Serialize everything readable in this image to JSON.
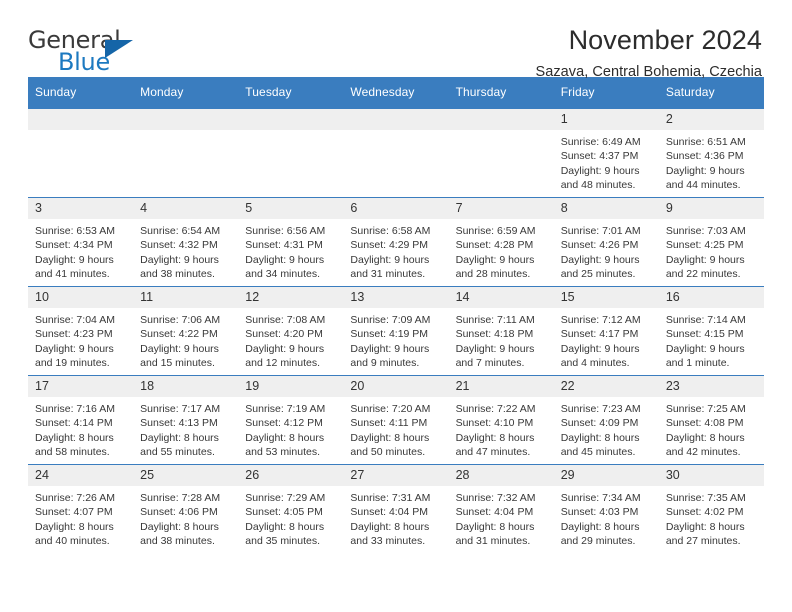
{
  "brand": {
    "name_part1": "General",
    "name_part2": "Blue"
  },
  "header": {
    "title": "November 2024",
    "subtitle": "Sazava, Central Bohemia, Czechia"
  },
  "colors": {
    "header_blue": "#3a7dbf",
    "daynum_gray": "#efefef",
    "brand_blue": "#1c79c0"
  },
  "calendar": {
    "weekdays": [
      "Sunday",
      "Monday",
      "Tuesday",
      "Wednesday",
      "Thursday",
      "Friday",
      "Saturday"
    ],
    "weeks": [
      [
        {
          "day": "",
          "blank": true,
          "sunrise": "",
          "sunset": "",
          "daylight1": "",
          "daylight2": ""
        },
        {
          "day": "",
          "blank": true,
          "sunrise": "",
          "sunset": "",
          "daylight1": "",
          "daylight2": ""
        },
        {
          "day": "",
          "blank": true,
          "sunrise": "",
          "sunset": "",
          "daylight1": "",
          "daylight2": ""
        },
        {
          "day": "",
          "blank": true,
          "sunrise": "",
          "sunset": "",
          "daylight1": "",
          "daylight2": ""
        },
        {
          "day": "",
          "blank": true,
          "sunrise": "",
          "sunset": "",
          "daylight1": "",
          "daylight2": ""
        },
        {
          "day": "1",
          "blank": false,
          "sunrise": "Sunrise: 6:49 AM",
          "sunset": "Sunset: 4:37 PM",
          "daylight1": "Daylight: 9 hours",
          "daylight2": "and 48 minutes."
        },
        {
          "day": "2",
          "blank": false,
          "sunrise": "Sunrise: 6:51 AM",
          "sunset": "Sunset: 4:36 PM",
          "daylight1": "Daylight: 9 hours",
          "daylight2": "and 44 minutes."
        }
      ],
      [
        {
          "day": "3",
          "blank": false,
          "sunrise": "Sunrise: 6:53 AM",
          "sunset": "Sunset: 4:34 PM",
          "daylight1": "Daylight: 9 hours",
          "daylight2": "and 41 minutes."
        },
        {
          "day": "4",
          "blank": false,
          "sunrise": "Sunrise: 6:54 AM",
          "sunset": "Sunset: 4:32 PM",
          "daylight1": "Daylight: 9 hours",
          "daylight2": "and 38 minutes."
        },
        {
          "day": "5",
          "blank": false,
          "sunrise": "Sunrise: 6:56 AM",
          "sunset": "Sunset: 4:31 PM",
          "daylight1": "Daylight: 9 hours",
          "daylight2": "and 34 minutes."
        },
        {
          "day": "6",
          "blank": false,
          "sunrise": "Sunrise: 6:58 AM",
          "sunset": "Sunset: 4:29 PM",
          "daylight1": "Daylight: 9 hours",
          "daylight2": "and 31 minutes."
        },
        {
          "day": "7",
          "blank": false,
          "sunrise": "Sunrise: 6:59 AM",
          "sunset": "Sunset: 4:28 PM",
          "daylight1": "Daylight: 9 hours",
          "daylight2": "and 28 minutes."
        },
        {
          "day": "8",
          "blank": false,
          "sunrise": "Sunrise: 7:01 AM",
          "sunset": "Sunset: 4:26 PM",
          "daylight1": "Daylight: 9 hours",
          "daylight2": "and 25 minutes."
        },
        {
          "day": "9",
          "blank": false,
          "sunrise": "Sunrise: 7:03 AM",
          "sunset": "Sunset: 4:25 PM",
          "daylight1": "Daylight: 9 hours",
          "daylight2": "and 22 minutes."
        }
      ],
      [
        {
          "day": "10",
          "blank": false,
          "sunrise": "Sunrise: 7:04 AM",
          "sunset": "Sunset: 4:23 PM",
          "daylight1": "Daylight: 9 hours",
          "daylight2": "and 19 minutes."
        },
        {
          "day": "11",
          "blank": false,
          "sunrise": "Sunrise: 7:06 AM",
          "sunset": "Sunset: 4:22 PM",
          "daylight1": "Daylight: 9 hours",
          "daylight2": "and 15 minutes."
        },
        {
          "day": "12",
          "blank": false,
          "sunrise": "Sunrise: 7:08 AM",
          "sunset": "Sunset: 4:20 PM",
          "daylight1": "Daylight: 9 hours",
          "daylight2": "and 12 minutes."
        },
        {
          "day": "13",
          "blank": false,
          "sunrise": "Sunrise: 7:09 AM",
          "sunset": "Sunset: 4:19 PM",
          "daylight1": "Daylight: 9 hours",
          "daylight2": "and 9 minutes."
        },
        {
          "day": "14",
          "blank": false,
          "sunrise": "Sunrise: 7:11 AM",
          "sunset": "Sunset: 4:18 PM",
          "daylight1": "Daylight: 9 hours",
          "daylight2": "and 7 minutes."
        },
        {
          "day": "15",
          "blank": false,
          "sunrise": "Sunrise: 7:12 AM",
          "sunset": "Sunset: 4:17 PM",
          "daylight1": "Daylight: 9 hours",
          "daylight2": "and 4 minutes."
        },
        {
          "day": "16",
          "blank": false,
          "sunrise": "Sunrise: 7:14 AM",
          "sunset": "Sunset: 4:15 PM",
          "daylight1": "Daylight: 9 hours",
          "daylight2": "and 1 minute."
        }
      ],
      [
        {
          "day": "17",
          "blank": false,
          "sunrise": "Sunrise: 7:16 AM",
          "sunset": "Sunset: 4:14 PM",
          "daylight1": "Daylight: 8 hours",
          "daylight2": "and 58 minutes."
        },
        {
          "day": "18",
          "blank": false,
          "sunrise": "Sunrise: 7:17 AM",
          "sunset": "Sunset: 4:13 PM",
          "daylight1": "Daylight: 8 hours",
          "daylight2": "and 55 minutes."
        },
        {
          "day": "19",
          "blank": false,
          "sunrise": "Sunrise: 7:19 AM",
          "sunset": "Sunset: 4:12 PM",
          "daylight1": "Daylight: 8 hours",
          "daylight2": "and 53 minutes."
        },
        {
          "day": "20",
          "blank": false,
          "sunrise": "Sunrise: 7:20 AM",
          "sunset": "Sunset: 4:11 PM",
          "daylight1": "Daylight: 8 hours",
          "daylight2": "and 50 minutes."
        },
        {
          "day": "21",
          "blank": false,
          "sunrise": "Sunrise: 7:22 AM",
          "sunset": "Sunset: 4:10 PM",
          "daylight1": "Daylight: 8 hours",
          "daylight2": "and 47 minutes."
        },
        {
          "day": "22",
          "blank": false,
          "sunrise": "Sunrise: 7:23 AM",
          "sunset": "Sunset: 4:09 PM",
          "daylight1": "Daylight: 8 hours",
          "daylight2": "and 45 minutes."
        },
        {
          "day": "23",
          "blank": false,
          "sunrise": "Sunrise: 7:25 AM",
          "sunset": "Sunset: 4:08 PM",
          "daylight1": "Daylight: 8 hours",
          "daylight2": "and 42 minutes."
        }
      ],
      [
        {
          "day": "24",
          "blank": false,
          "sunrise": "Sunrise: 7:26 AM",
          "sunset": "Sunset: 4:07 PM",
          "daylight1": "Daylight: 8 hours",
          "daylight2": "and 40 minutes."
        },
        {
          "day": "25",
          "blank": false,
          "sunrise": "Sunrise: 7:28 AM",
          "sunset": "Sunset: 4:06 PM",
          "daylight1": "Daylight: 8 hours",
          "daylight2": "and 38 minutes."
        },
        {
          "day": "26",
          "blank": false,
          "sunrise": "Sunrise: 7:29 AM",
          "sunset": "Sunset: 4:05 PM",
          "daylight1": "Daylight: 8 hours",
          "daylight2": "and 35 minutes."
        },
        {
          "day": "27",
          "blank": false,
          "sunrise": "Sunrise: 7:31 AM",
          "sunset": "Sunset: 4:04 PM",
          "daylight1": "Daylight: 8 hours",
          "daylight2": "and 33 minutes."
        },
        {
          "day": "28",
          "blank": false,
          "sunrise": "Sunrise: 7:32 AM",
          "sunset": "Sunset: 4:04 PM",
          "daylight1": "Daylight: 8 hours",
          "daylight2": "and 31 minutes."
        },
        {
          "day": "29",
          "blank": false,
          "sunrise": "Sunrise: 7:34 AM",
          "sunset": "Sunset: 4:03 PM",
          "daylight1": "Daylight: 8 hours",
          "daylight2": "and 29 minutes."
        },
        {
          "day": "30",
          "blank": false,
          "sunrise": "Sunrise: 7:35 AM",
          "sunset": "Sunset: 4:02 PM",
          "daylight1": "Daylight: 8 hours",
          "daylight2": "and 27 minutes."
        }
      ]
    ]
  }
}
